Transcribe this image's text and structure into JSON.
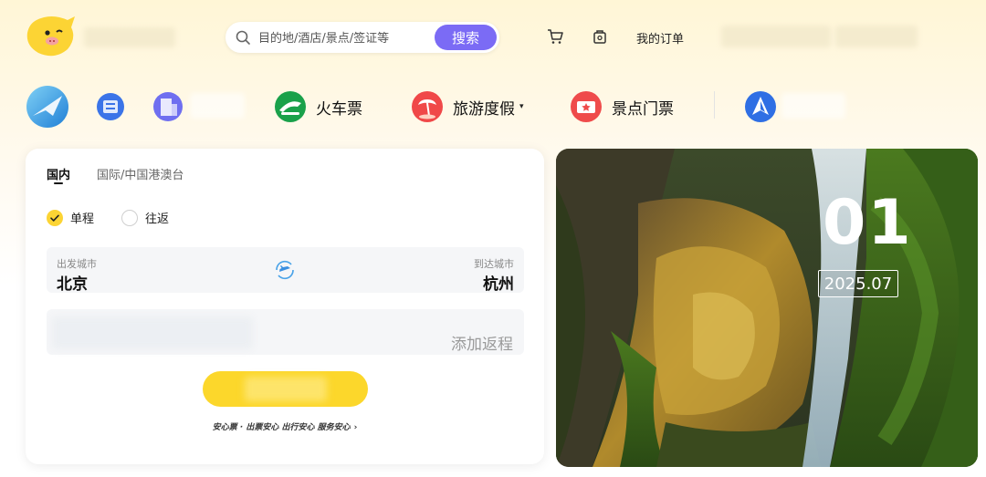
{
  "header": {
    "search": {
      "placeholder": "目的地/酒店/景点/签证等",
      "button_label": "搜索"
    },
    "orders_label": "我的订单"
  },
  "nav": {
    "items": [
      {
        "label": "火车票",
        "icon": "train-icon",
        "color": "#1aa14a"
      },
      {
        "label": "旅游度假",
        "icon": "vacation-icon",
        "color": "#f04848",
        "has_dropdown": true,
        "caret": "▾"
      },
      {
        "label": "景点门票",
        "icon": "ticket-icon",
        "color": "#ef4b4b"
      }
    ]
  },
  "booking": {
    "tabs": [
      {
        "label": "国内",
        "active": true
      },
      {
        "label": "国际/中国港澳台",
        "active": false
      }
    ],
    "trip_types": [
      {
        "label": "单程",
        "selected": true
      },
      {
        "label": "往返",
        "selected": false
      }
    ],
    "departure": {
      "caption": "出发城市",
      "value": "北京"
    },
    "arrival": {
      "caption": "到达城市",
      "value": "杭州"
    },
    "return_label": "添加返程",
    "assurance": {
      "text": "安心票 · 出票安心 出行安心 服务安心",
      "chevron": "›"
    }
  },
  "banner": {
    "day": "01",
    "month": "2025.07"
  },
  "colors": {
    "accent": "#fcd72b",
    "search_button": "#7b6bf5",
    "brand_yellow": "#fcd434"
  }
}
